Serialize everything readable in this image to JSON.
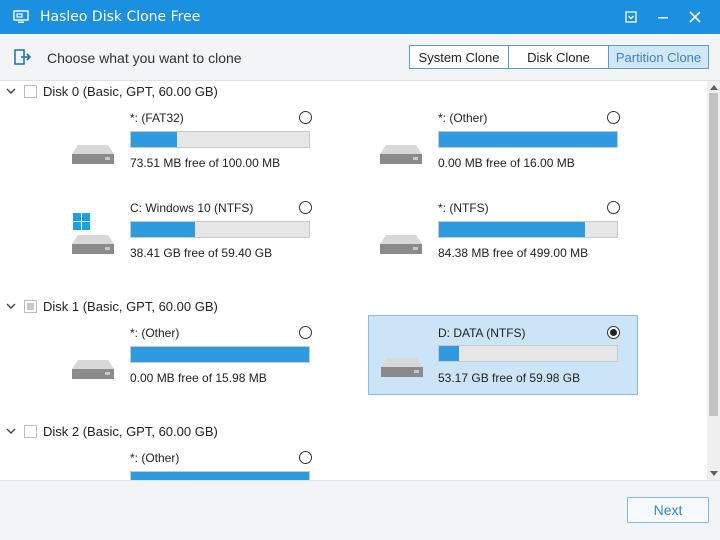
{
  "window": {
    "title": "Hasleo Disk Clone Free",
    "accent": "#1b8fe0"
  },
  "header": {
    "prompt": "Choose what you want to clone",
    "modes": [
      {
        "label": "System Clone",
        "active": false
      },
      {
        "label": "Disk Clone",
        "active": false
      },
      {
        "label": "Partition Clone",
        "active": true
      }
    ]
  },
  "disks": [
    {
      "label": "Disk 0 (Basic, GPT, 60.00 GB)",
      "checked": "unchecked",
      "partitions": [
        {
          "name": "*: (FAT32)",
          "free": "73.51 MB free of 100.00 MB",
          "used_fraction": 0.26,
          "selected": false,
          "icon": "drive-icon"
        },
        {
          "name": "*: (Other)",
          "free": "0.00 MB free of 16.00 MB",
          "used_fraction": 1.0,
          "selected": false,
          "icon": "drive-icon"
        },
        {
          "name": "C: Windows 10 (NTFS)",
          "free": "38.41 GB free of 59.40 GB",
          "used_fraction": 0.36,
          "selected": false,
          "icon": "windows-drive-icon"
        },
        {
          "name": "*: (NTFS)",
          "free": "84.38 MB free of 499.00 MB",
          "used_fraction": 0.82,
          "selected": false,
          "icon": "drive-icon"
        }
      ]
    },
    {
      "label": "Disk 1 (Basic, GPT, 60.00 GB)",
      "checked": "partial",
      "partitions": [
        {
          "name": "*: (Other)",
          "free": "0.00 MB free of 15.98 MB",
          "used_fraction": 1.0,
          "selected": false,
          "icon": "drive-icon"
        },
        {
          "name": "D: DATA (NTFS)",
          "free": "53.17 GB free of 59.98 GB",
          "used_fraction": 0.11,
          "selected": true,
          "icon": "drive-icon"
        }
      ]
    },
    {
      "label": "Disk 2 (Basic, GPT, 60.00 GB)",
      "checked": "unchecked",
      "partitions": [
        {
          "name": "*: (Other)",
          "free": "",
          "used_fraction": 1.0,
          "selected": false,
          "icon": "drive-icon"
        }
      ]
    }
  ],
  "footer": {
    "next_label": "Next"
  }
}
